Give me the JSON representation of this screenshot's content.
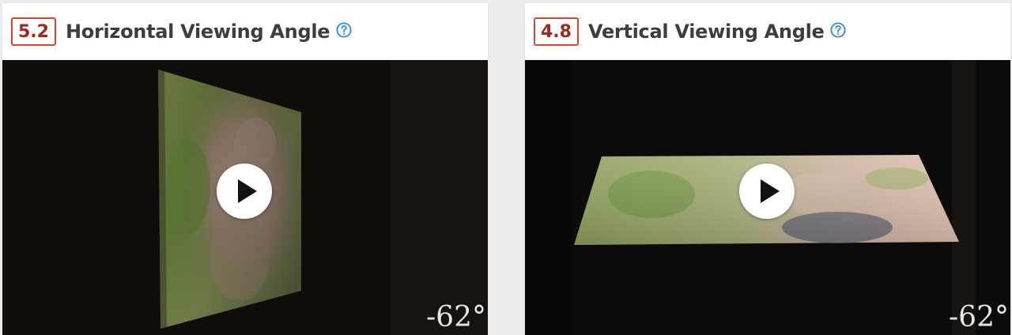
{
  "cards": [
    {
      "score": "5.2",
      "title": "Horizontal Viewing Angle",
      "help_icon": "question-circle-icon",
      "video": {
        "play_icon": "play-icon",
        "angle_overlay": "-62°"
      }
    },
    {
      "score": "4.8",
      "title": "Vertical Viewing Angle",
      "help_icon": "question-circle-icon",
      "video": {
        "play_icon": "play-icon",
        "angle_overlay": "-62°"
      }
    }
  ],
  "colors": {
    "score_border": "#d9452b",
    "score_text": "#a3271b",
    "title_text": "#3d3d3d",
    "help_icon": "#2a8ae0",
    "video_background": "#0f0c0a",
    "page_background": "#ececec"
  }
}
